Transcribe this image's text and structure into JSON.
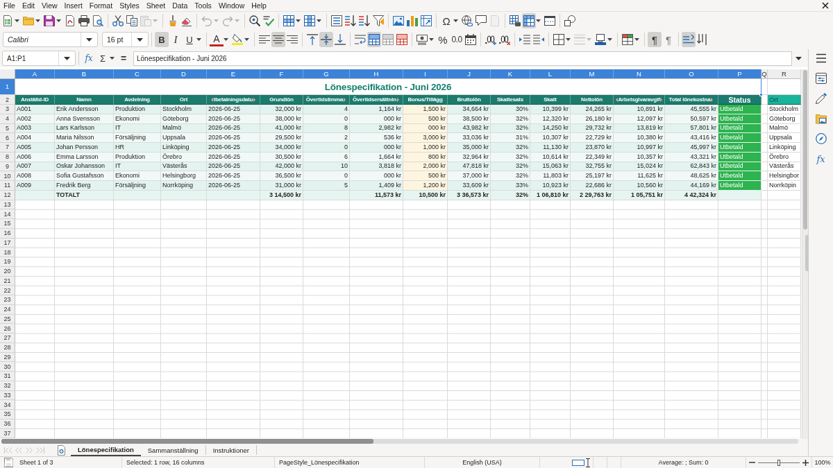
{
  "menu_bar": {
    "items": [
      "File",
      "Edit",
      "View",
      "Insert",
      "Format",
      "Styles",
      "Sheet",
      "Data",
      "Tools",
      "Window",
      "Help"
    ]
  },
  "standard_toolbar": {
    "paste_disabled": true,
    "undo_disabled": true,
    "redo_disabled": true,
    "special_character_label": "Ω",
    "header_footer_disabled": true,
    "freeze_rows_columns": true
  },
  "formatting_toolbar": {
    "font_name": "Calibri",
    "font_size": "16 pt",
    "bold": {
      "label": "B",
      "on": true
    },
    "italic": {
      "label": "I",
      "on": false
    },
    "underline": {
      "label": "U",
      "on": false
    },
    "font_color_label": "A",
    "align_left": false,
    "align_center": true,
    "align_right": false,
    "align_top": false,
    "align_middle": true,
    "align_bottom": false,
    "merge_and_center": true,
    "percent_label": "%",
    "number_label": "0.0",
    "line_style_disabled": true,
    "left_to_right": {
      "label": "¶",
      "on": true
    },
    "right_to_left": {
      "label": "¶",
      "on": false
    },
    "text_horizontal": true,
    "text_vertical": false
  },
  "formula_bar": {
    "name_box": "A1:P1",
    "function_wizard": "fx",
    "sum": "Σ",
    "equals": "=",
    "formula": "Lönespecifikation - Juni 2026"
  },
  "sheet": {
    "columns": [
      {
        "label": "A",
        "selected": true
      },
      {
        "label": "B",
        "selected": true
      },
      {
        "label": "C",
        "selected": true
      },
      {
        "label": "D",
        "selected": true
      },
      {
        "label": "E",
        "selected": true
      },
      {
        "label": "F",
        "selected": true
      },
      {
        "label": "G",
        "selected": true
      },
      {
        "label": "H",
        "selected": true
      },
      {
        "label": "I",
        "selected": true
      },
      {
        "label": "J",
        "selected": true
      },
      {
        "label": "K",
        "selected": true
      },
      {
        "label": "L",
        "selected": true
      },
      {
        "label": "M",
        "selected": true
      },
      {
        "label": "N",
        "selected": true
      },
      {
        "label": "O",
        "selected": true
      },
      {
        "label": "P",
        "selected": true
      },
      {
        "label": "Q",
        "selected": false
      },
      {
        "label": "R",
        "selected": false
      }
    ],
    "rows": [
      {
        "kind": "title",
        "number": "1",
        "selected": true,
        "title": "Lönespecifikation - Juni 2026"
      },
      {
        "kind": "header",
        "number": "2",
        "selected": false,
        "cells": [
          {
            "text": "Anställd-ID",
            "clipped_left": false,
            "clipped_right": false
          },
          {
            "text": "Namn",
            "clipped_left": false,
            "clipped_right": false
          },
          {
            "text": "Avdelning",
            "clipped_left": false,
            "clipped_right": false
          },
          {
            "text": "Ort",
            "clipped_left": false,
            "clipped_right": false
          },
          {
            "text": "tbetalningsdatu",
            "clipped_left": true,
            "clipped_right": true
          },
          {
            "text": "Grundlön",
            "clipped_left": false,
            "clipped_right": false
          },
          {
            "text": "Övertidstimma",
            "clipped_left": false,
            "clipped_right": true
          },
          {
            "text": "Övertidsersättnin",
            "clipped_left": false,
            "clipped_right": true
          },
          {
            "text": "Bonus/Tillägg",
            "clipped_left": false,
            "clipped_right": false
          },
          {
            "text": "Bruttolön",
            "clipped_left": false,
            "clipped_right": false
          },
          {
            "text": "Skattesats",
            "clipped_left": false,
            "clipped_right": false
          },
          {
            "text": "Skatt",
            "clipped_left": false,
            "clipped_right": false
          },
          {
            "text": "Nettolön",
            "clipped_left": false,
            "clipped_right": false
          },
          {
            "text": "Arbetsgivaravgif",
            "clipped_left": true,
            "clipped_right": true
          },
          {
            "text": "Total lönekostna",
            "clipped_left": false,
            "clipped_right": true
          },
          {
            "text": "Status",
            "clipped_left": false,
            "clipped_right": false
          },
          null,
          {
            "text": "Ort",
            "clipped_left": false,
            "clipped_right": false
          }
        ]
      },
      {
        "kind": "data",
        "number": "3",
        "selected": false,
        "cells": [
          "A001",
          "Erik Andersson",
          "Produktion",
          "Stockholm",
          "2026-06-25",
          "32,000 kr",
          "4",
          "1,164 kr",
          "1,500 kr",
          "34,664 kr",
          "30%",
          "10,399 kr",
          "24,265 kr",
          "10,891 kr",
          "45,555 kr",
          "Utbetald",
          null,
          "Stockholm"
        ]
      },
      {
        "kind": "data",
        "number": "4",
        "selected": false,
        "cells": [
          "A002",
          "Anna Svensson",
          "Ekonomi",
          "Göteborg",
          "2026-06-25",
          "38,000 kr",
          "0",
          "000 kr",
          "500 kr",
          "38,500 kr",
          "32%",
          "12,320 kr",
          "26,180 kr",
          "12,097 kr",
          "50,597 kr",
          "Utbetald",
          null,
          "Göteborg"
        ]
      },
      {
        "kind": "data",
        "number": "5",
        "selected": false,
        "cells": [
          "A003",
          "Lars Karlsson",
          "IT",
          "Malmö",
          "2026-06-25",
          "41,000 kr",
          "8",
          "2,982 kr",
          "000 kr",
          "43,982 kr",
          "32%",
          "14,250 kr",
          "29,732 kr",
          "13,819 kr",
          "57,801 kr",
          "Utbetald",
          null,
          "Malmö"
        ]
      },
      {
        "kind": "data",
        "number": "6",
        "selected": false,
        "cells": [
          "A004",
          "Maria Nilsson",
          "Försäljning",
          "Uppsala",
          "2026-06-25",
          "29,500 kr",
          "2",
          "536 kr",
          "3,000 kr",
          "33,036 kr",
          "31%",
          "10,307 kr",
          "22,729 kr",
          "10,380 kr",
          "43,416 kr",
          "Utbetald",
          null,
          "Uppsala"
        ]
      },
      {
        "kind": "data",
        "number": "7",
        "selected": false,
        "cells": [
          "A005",
          "Johan Persson",
          "HR",
          "Linköping",
          "2026-06-25",
          "34,000 kr",
          "0",
          "000 kr",
          "1,000 kr",
          "35,000 kr",
          "32%",
          "11,130 kr",
          "23,870 kr",
          "10,997 kr",
          "45,997 kr",
          "Utbetald",
          null,
          "Linköping"
        ]
      },
      {
        "kind": "data",
        "number": "8",
        "selected": false,
        "cells": [
          "A006",
          "Emma Larsson",
          "Produktion",
          "Örebro",
          "2026-06-25",
          "30,500 kr",
          "6",
          "1,664 kr",
          "800 kr",
          "32,964 kr",
          "32%",
          "10,614 kr",
          "22,349 kr",
          "10,357 kr",
          "43,321 kr",
          "Utbetald",
          null,
          "Örebro"
        ]
      },
      {
        "kind": "data",
        "number": "9",
        "selected": false,
        "cells": [
          "A007",
          "Oskar Johansson",
          "IT",
          "Västerås",
          "2026-06-25",
          "42,000 kr",
          "10",
          "3,818 kr",
          "2,000 kr",
          "47,818 kr",
          "32%",
          "15,063 kr",
          "32,755 kr",
          "15,024 kr",
          "62,843 kr",
          "Utbetald",
          null,
          "Västerås"
        ]
      },
      {
        "kind": "data",
        "number": "10",
        "selected": false,
        "cells": [
          "A008",
          "Sofia Gustafsson",
          "Ekonomi",
          "Helsingborg",
          "2026-06-25",
          "36,500 kr",
          "0",
          "000 kr",
          "500 kr",
          "37,000 kr",
          "32%",
          "11,803 kr",
          "25,197 kr",
          "11,625 kr",
          "48,625 kr",
          "Utbetald",
          null,
          "Helsingbor"
        ]
      },
      {
        "kind": "data",
        "number": "11",
        "selected": false,
        "cells": [
          "A009",
          "Fredrik Berg",
          "Försäljning",
          "Norrköping",
          "2026-06-25",
          "31,000 kr",
          "5",
          "1,409 kr",
          "1,200 kr",
          "33,609 kr",
          "33%",
          "10,923 kr",
          "22,686 kr",
          "10,560 kr",
          "44,169 kr",
          "Utbetald",
          null,
          "Norrköpin"
        ]
      },
      {
        "kind": "total",
        "number": "12",
        "selected": false,
        "cells": [
          null,
          "TOTALT",
          null,
          null,
          null,
          "3 14,500 kr",
          null,
          "11,573 kr",
          "10,500 kr",
          "3 36,573 kr",
          "32%",
          "1 06,810 kr",
          "2 29,763 kr",
          "1 05,751 kr",
          "4 42,324 kr",
          null,
          null,
          null
        ]
      },
      {
        "kind": "empty",
        "number": "13",
        "selected": false
      },
      {
        "kind": "empty",
        "number": "14",
        "selected": false
      },
      {
        "kind": "empty",
        "number": "15",
        "selected": false
      },
      {
        "kind": "empty",
        "number": "16",
        "selected": false
      },
      {
        "kind": "empty",
        "number": "17",
        "selected": false
      },
      {
        "kind": "empty",
        "number": "18",
        "selected": false
      },
      {
        "kind": "empty",
        "number": "19",
        "selected": false
      },
      {
        "kind": "empty",
        "number": "20",
        "selected": false
      },
      {
        "kind": "empty",
        "number": "21",
        "selected": false
      },
      {
        "kind": "empty",
        "number": "22",
        "selected": false
      },
      {
        "kind": "empty",
        "number": "23",
        "selected": false
      },
      {
        "kind": "empty",
        "number": "24",
        "selected": false
      },
      {
        "kind": "empty",
        "number": "25",
        "selected": false
      },
      {
        "kind": "empty",
        "number": "26",
        "selected": false
      },
      {
        "kind": "empty",
        "number": "27",
        "selected": false
      },
      {
        "kind": "empty",
        "number": "28",
        "selected": false
      },
      {
        "kind": "empty",
        "number": "29",
        "selected": false
      },
      {
        "kind": "empty",
        "number": "30",
        "selected": false
      },
      {
        "kind": "empty",
        "number": "31",
        "selected": false
      },
      {
        "kind": "empty",
        "number": "32",
        "selected": false
      },
      {
        "kind": "empty",
        "number": "33",
        "selected": false
      },
      {
        "kind": "empty",
        "number": "34",
        "selected": false
      },
      {
        "kind": "empty",
        "number": "35",
        "selected": false
      },
      {
        "kind": "empty",
        "number": "36",
        "selected": false
      },
      {
        "kind": "empty",
        "number": "37",
        "selected": false
      }
    ]
  },
  "sheet_tabs": {
    "navigation_disabled": true,
    "tabs": [
      {
        "label": "Lönespecifikation",
        "selected": true
      },
      {
        "label": "Sammanställning",
        "selected": false
      },
      {
        "label": "Instruktioner",
        "selected": false
      }
    ]
  },
  "sidebar": {
    "functions_label": "fx"
  },
  "status_bar": {
    "sheet": "Sheet 1 of 3",
    "selection": "Selected: 1 row, 16 columns",
    "page_style": "PageStyle_Lönespecifikation",
    "language": "English (USA)",
    "summary": "Average: ; Sum: 0",
    "zoom": {
      "level": 0.5,
      "reading": "100%"
    }
  }
}
